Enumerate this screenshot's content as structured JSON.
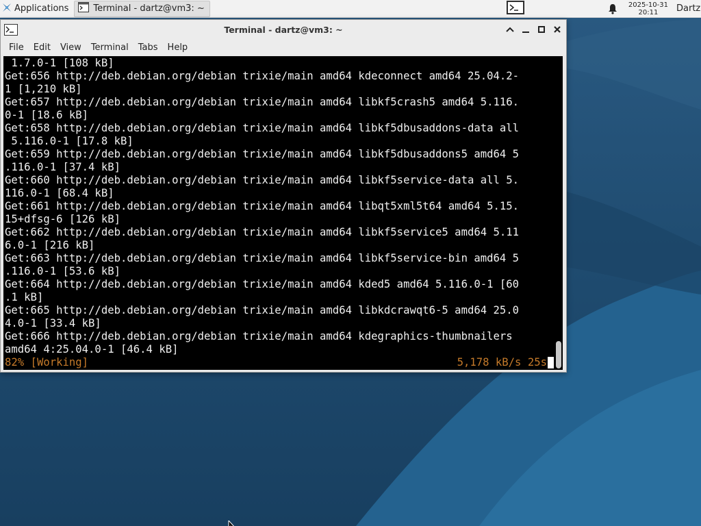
{
  "panel": {
    "applications_label": "Applications",
    "task_label": "Terminal - dartz@vm3: ~",
    "clock_date": "2025-10-31",
    "clock_time": "20:11",
    "user_label": "Dartz"
  },
  "window": {
    "title": "Terminal - dartz@vm3: ~",
    "menu": [
      "File",
      "Edit",
      "View",
      "Terminal",
      "Tabs",
      "Help"
    ]
  },
  "terminal": {
    "lines": [
      " 1.7.0-1 [108 kB]",
      "Get:656 http://deb.debian.org/debian trixie/main amd64 kdeconnect amd64 25.04.2-",
      "1 [1,210 kB]",
      "Get:657 http://deb.debian.org/debian trixie/main amd64 libkf5crash5 amd64 5.116.",
      "0-1 [18.6 kB]",
      "Get:658 http://deb.debian.org/debian trixie/main amd64 libkf5dbusaddons-data all",
      " 5.116.0-1 [17.8 kB]",
      "Get:659 http://deb.debian.org/debian trixie/main amd64 libkf5dbusaddons5 amd64 5",
      ".116.0-1 [37.4 kB]",
      "Get:660 http://deb.debian.org/debian trixie/main amd64 libkf5service-data all 5.",
      "116.0-1 [68.4 kB]",
      "Get:661 http://deb.debian.org/debian trixie/main amd64 libqt5xml5t64 amd64 5.15.",
      "15+dfsg-6 [126 kB]",
      "Get:662 http://deb.debian.org/debian trixie/main amd64 libkf5service5 amd64 5.11",
      "6.0-1 [216 kB]",
      "Get:663 http://deb.debian.org/debian trixie/main amd64 libkf5service-bin amd64 5",
      ".116.0-1 [53.6 kB]",
      "Get:664 http://deb.debian.org/debian trixie/main amd64 kded5 amd64 5.116.0-1 [60",
      ".1 kB]",
      "Get:665 http://deb.debian.org/debian trixie/main amd64 libkdcrawqt6-5 amd64 25.0",
      "4.0-1 [33.4 kB]",
      "Get:666 http://deb.debian.org/debian trixie/main amd64 kdegraphics-thumbnailers",
      "amd64 4:25.04.0-1 [46.4 kB]"
    ],
    "status_left": "82% [Working]",
    "status_right": "5,178 kB/s 25s"
  },
  "colors": {
    "status_text": "#c57a2a",
    "terminal_bg": "#000000",
    "terminal_fg": "#f0f0f0"
  }
}
